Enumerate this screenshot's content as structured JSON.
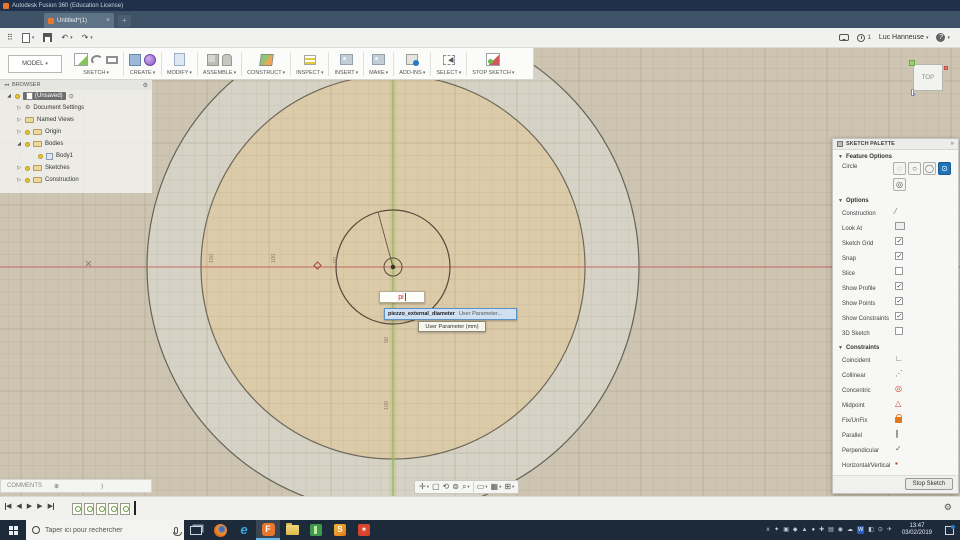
{
  "app": {
    "title": "Autodesk Fusion 360 (Education License)"
  },
  "tabs": {
    "active": "Untitled*(1)"
  },
  "account": {
    "user": "Luc Hanneuse",
    "notif_count": "1"
  },
  "ribbon": {
    "workspace": "MODEL",
    "groups": [
      {
        "label": "SKETCH"
      },
      {
        "label": "CREATE"
      },
      {
        "label": "MODIFY"
      },
      {
        "label": "ASSEMBLE"
      },
      {
        "label": "CONSTRUCT"
      },
      {
        "label": "INSPECT"
      },
      {
        "label": "INSERT"
      },
      {
        "label": "MAKE"
      },
      {
        "label": "ADD-INS"
      },
      {
        "label": "SELECT"
      },
      {
        "label": "STOP SKETCH"
      }
    ]
  },
  "browser": {
    "header": "BROWSER",
    "root": "(Unsaved)",
    "items": [
      {
        "label": "Document Settings"
      },
      {
        "label": "Named Views"
      },
      {
        "label": "Origin"
      },
      {
        "label": "Bodies"
      },
      {
        "label": "Body1"
      },
      {
        "label": "Sketches"
      },
      {
        "label": "Construction"
      }
    ]
  },
  "viewcube": {
    "face": "TOP",
    "z_axis": "z"
  },
  "canvas": {
    "axis_labels_x": [
      "150",
      "100",
      "50"
    ],
    "axis_labels_y": [
      "50",
      "100"
    ],
    "dim_input": "pi",
    "autocomplete": {
      "name": "piezzo_external_diameter",
      "kind": "User Parameter..."
    },
    "tooltip": "User Parameter (mm)"
  },
  "palette": {
    "header": "SKETCH PALETTE",
    "feature_options_title": "Feature Options",
    "tool_label": "Circle",
    "options_title": "Options",
    "options": [
      {
        "label": "Construction",
        "checked": false
      },
      {
        "label": "Look At",
        "checked": false
      },
      {
        "label": "Sketch Grid",
        "checked": true
      },
      {
        "label": "Snap",
        "checked": true
      },
      {
        "label": "Slice",
        "checked": false
      },
      {
        "label": "Show Profile",
        "checked": true
      },
      {
        "label": "Show Points",
        "checked": true
      },
      {
        "label": "Show Constraints",
        "checked": true
      },
      {
        "label": "3D Sketch",
        "checked": false
      }
    ],
    "constraints_title": "Constraints",
    "constraints": [
      {
        "label": "Coincident"
      },
      {
        "label": "Collinear"
      },
      {
        "label": "Concentric"
      },
      {
        "label": "Midpoint"
      },
      {
        "label": "Fix/UnFix"
      },
      {
        "label": "Parallel"
      },
      {
        "label": "Perpendicular"
      },
      {
        "label": "Horizontal/Vertical"
      }
    ],
    "stop_button": "Stop Sketch"
  },
  "comments": {
    "label": "COMMENTS"
  },
  "taskbar": {
    "search_placeholder": "Taper ici pour rechercher",
    "time": "13:47",
    "date": "03/02/2019",
    "tray": [
      "∧",
      "✦",
      "▣",
      "◆",
      "▲",
      "●",
      "✚",
      "▤",
      "◉",
      "☁",
      "W",
      "◧",
      "⊙",
      "✈"
    ]
  },
  "colors": {
    "accent_blue": "#1f74b8",
    "canvas_face": "#dccba9",
    "canvas_ring": "#d6d3c6",
    "axis_red": "#c4574f",
    "axis_green": "#95ad62",
    "taskbar_bg": "#1c2a3a",
    "fusion_orange": "#e8762c"
  }
}
